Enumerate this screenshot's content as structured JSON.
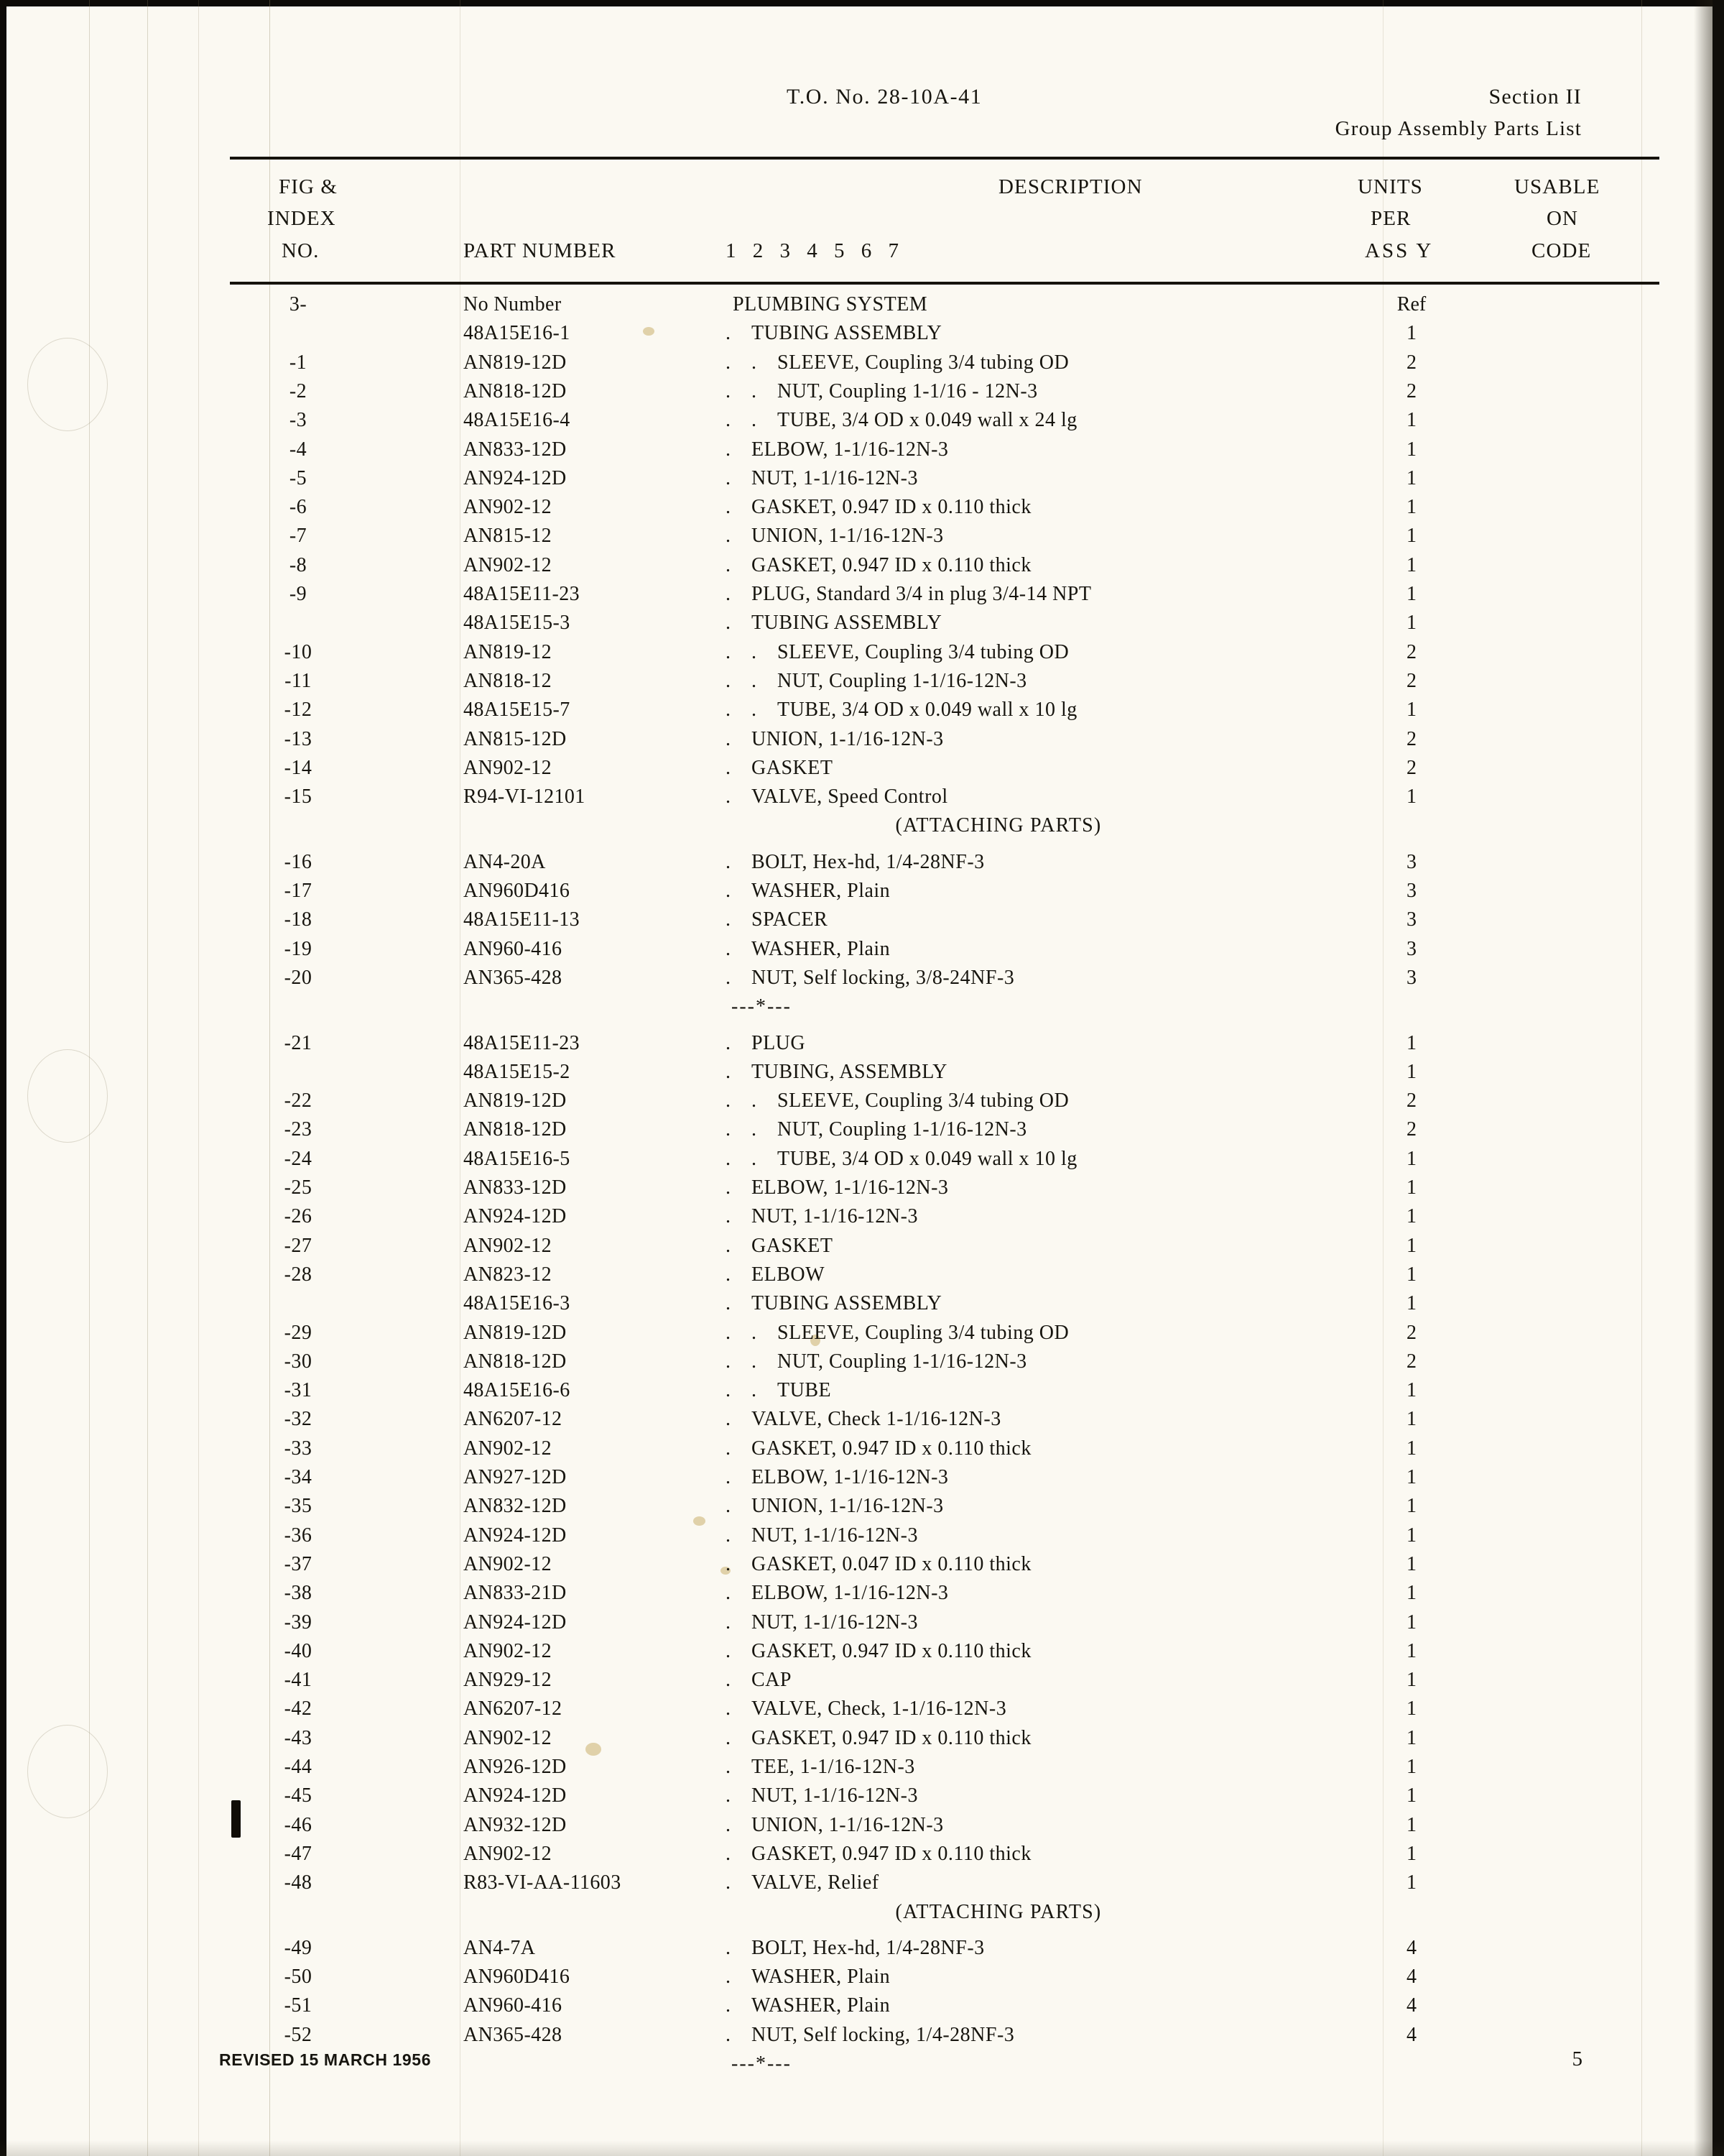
{
  "header": {
    "doc_title": "T.O. No. 28-10A-41",
    "section": "Section II",
    "section_sub": "Group Assembly Parts List"
  },
  "columns": {
    "fig": "FIG &",
    "index": "INDEX",
    "no": "NO.",
    "part_number": "PART NUMBER",
    "desc_digits": "1 2 3 4 5 6 7",
    "description": "DESCRIPTION",
    "units": "UNITS",
    "per": "PER",
    "assy": "ASS Y",
    "usable": "USABLE",
    "on": "ON",
    "code": "CODE"
  },
  "separator_glyph": "---*---",
  "attaching_parts_label": "(ATTACHING PARTS)",
  "rows": [
    {
      "index": "3-",
      "part": "No Number",
      "indent": 0,
      "desc": "PLUMBING SYSTEM",
      "units": "Ref"
    },
    {
      "index": "",
      "part": "48A15E16-1",
      "indent": 1,
      "desc": "TUBING ASSEMBLY",
      "units": "1"
    },
    {
      "index": "-1",
      "part": "AN819-12D",
      "indent": 2,
      "desc": "SLEEVE, Coupling 3/4 tubing OD",
      "units": "2"
    },
    {
      "index": "-2",
      "part": "AN818-12D",
      "indent": 2,
      "desc": "NUT, Coupling 1-1/16 - 12N-3",
      "units": "2"
    },
    {
      "index": "-3",
      "part": "48A15E16-4",
      "indent": 2,
      "desc": "TUBE, 3/4 OD x 0.049 wall x 24 lg",
      "units": "1"
    },
    {
      "index": "-4",
      "part": "AN833-12D",
      "indent": 1,
      "desc": "ELBOW, 1-1/16-12N-3",
      "units": "1"
    },
    {
      "index": "-5",
      "part": "AN924-12D",
      "indent": 1,
      "desc": "NUT, 1-1/16-12N-3",
      "units": "1"
    },
    {
      "index": "-6",
      "part": "AN902-12",
      "indent": 1,
      "desc": "GASKET, 0.947 ID x 0.110 thick",
      "units": "1"
    },
    {
      "index": "-7",
      "part": "AN815-12",
      "indent": 1,
      "desc": "UNION, 1-1/16-12N-3",
      "units": "1"
    },
    {
      "index": "-8",
      "part": "AN902-12",
      "indent": 1,
      "desc": "GASKET, 0.947 ID x 0.110 thick",
      "units": "1"
    },
    {
      "index": "-9",
      "part": "48A15E11-23",
      "indent": 1,
      "desc": "PLUG, Standard 3/4 in plug 3/4-14 NPT",
      "units": "1"
    },
    {
      "index": "",
      "part": "48A15E15-3",
      "indent": 1,
      "desc": "TUBING ASSEMBLY",
      "units": "1"
    },
    {
      "index": "-10",
      "part": "AN819-12",
      "indent": 2,
      "desc": "SLEEVE, Coupling 3/4 tubing OD",
      "units": "2"
    },
    {
      "index": "-11",
      "part": "AN818-12",
      "indent": 2,
      "desc": "NUT, Coupling 1-1/16-12N-3",
      "units": "2"
    },
    {
      "index": "-12",
      "part": "48A15E15-7",
      "indent": 2,
      "desc": "TUBE, 3/4 OD x 0.049 wall x 10 lg",
      "units": "1"
    },
    {
      "index": "-13",
      "part": "AN815-12D",
      "indent": 1,
      "desc": "UNION, 1-1/16-12N-3",
      "units": "2"
    },
    {
      "index": "-14",
      "part": "AN902-12",
      "indent": 1,
      "desc": "GASKET",
      "units": "2"
    },
    {
      "index": "-15",
      "part": "R94-VI-12101",
      "indent": 1,
      "desc": "VALVE, Speed Control",
      "units": "1"
    },
    {
      "type": "attaching"
    },
    {
      "index": "-16",
      "part": "AN4-20A",
      "indent": 1,
      "desc": "BOLT, Hex-hd, 1/4-28NF-3",
      "units": "3"
    },
    {
      "index": "-17",
      "part": "AN960D416",
      "indent": 1,
      "desc": "WASHER, Plain",
      "units": "3"
    },
    {
      "index": "-18",
      "part": "48A15E11-13",
      "indent": 1,
      "desc": "SPACER",
      "units": "3"
    },
    {
      "index": "-19",
      "part": "AN960-416",
      "indent": 1,
      "desc": "WASHER, Plain",
      "units": "3"
    },
    {
      "index": "-20",
      "part": "AN365-428",
      "indent": 1,
      "desc": "NUT, Self locking, 3/8-24NF-3",
      "units": "3"
    },
    {
      "type": "separator"
    },
    {
      "index": "-21",
      "part": "48A15E11-23",
      "indent": 1,
      "desc": "PLUG",
      "units": "1"
    },
    {
      "index": "",
      "part": "48A15E15-2",
      "indent": 1,
      "desc": "TUBING, ASSEMBLY",
      "units": "1"
    },
    {
      "index": "-22",
      "part": "AN819-12D",
      "indent": 2,
      "desc": "SLEEVE, Coupling 3/4 tubing OD",
      "units": "2"
    },
    {
      "index": "-23",
      "part": "AN818-12D",
      "indent": 2,
      "desc": "NUT, Coupling 1-1/16-12N-3",
      "units": "2"
    },
    {
      "index": "-24",
      "part": "48A15E16-5",
      "indent": 2,
      "desc": "TUBE, 3/4 OD x 0.049 wall x 10 lg",
      "units": "1"
    },
    {
      "index": "-25",
      "part": "AN833-12D",
      "indent": 1,
      "desc": "ELBOW, 1-1/16-12N-3",
      "units": "1"
    },
    {
      "index": "-26",
      "part": "AN924-12D",
      "indent": 1,
      "desc": "NUT, 1-1/16-12N-3",
      "units": "1"
    },
    {
      "index": "-27",
      "part": "AN902-12",
      "indent": 1,
      "desc": "GASKET",
      "units": "1"
    },
    {
      "index": "-28",
      "part": "AN823-12",
      "indent": 1,
      "desc": "ELBOW",
      "units": "1"
    },
    {
      "index": "",
      "part": "48A15E16-3",
      "indent": 1,
      "desc": "TUBING ASSEMBLY",
      "units": "1"
    },
    {
      "index": "-29",
      "part": "AN819-12D",
      "indent": 2,
      "desc": "SLEEVE, Coupling 3/4 tubing OD",
      "units": "2"
    },
    {
      "index": "-30",
      "part": "AN818-12D",
      "indent": 2,
      "desc": "NUT, Coupling 1-1/16-12N-3",
      "units": "2"
    },
    {
      "index": "-31",
      "part": "48A15E16-6",
      "indent": 2,
      "desc": "TUBE",
      "units": "1"
    },
    {
      "index": "-32",
      "part": "AN6207-12",
      "indent": 1,
      "desc": "VALVE, Check 1-1/16-12N-3",
      "units": "1"
    },
    {
      "index": "-33",
      "part": "AN902-12",
      "indent": 1,
      "desc": "GASKET, 0.947 ID x 0.110 thick",
      "units": "1"
    },
    {
      "index": "-34",
      "part": "AN927-12D",
      "indent": 1,
      "desc": "ELBOW, 1-1/16-12N-3",
      "units": "1"
    },
    {
      "index": "-35",
      "part": "AN832-12D",
      "indent": 1,
      "desc": "UNION, 1-1/16-12N-3",
      "units": "1"
    },
    {
      "index": "-36",
      "part": "AN924-12D",
      "indent": 1,
      "desc": "NUT, 1-1/16-12N-3",
      "units": "1"
    },
    {
      "index": "-37",
      "part": "AN902-12",
      "indent": 1,
      "desc": "GASKET, 0.047 ID x 0.110 thick",
      "units": "1"
    },
    {
      "index": "-38",
      "part": "AN833-21D",
      "indent": 1,
      "desc": "ELBOW, 1-1/16-12N-3",
      "units": "1"
    },
    {
      "index": "-39",
      "part": "AN924-12D",
      "indent": 1,
      "desc": "NUT, 1-1/16-12N-3",
      "units": "1"
    },
    {
      "index": "-40",
      "part": "AN902-12",
      "indent": 1,
      "desc": "GASKET, 0.947 ID x 0.110 thick",
      "units": "1"
    },
    {
      "index": "-41",
      "part": "AN929-12",
      "indent": 1,
      "desc": "CAP",
      "units": "1"
    },
    {
      "index": "-42",
      "part": "AN6207-12",
      "indent": 1,
      "desc": "VALVE, Check, 1-1/16-12N-3",
      "units": "1"
    },
    {
      "index": "-43",
      "part": "AN902-12",
      "indent": 1,
      "desc": "GASKET, 0.947 ID x 0.110 thick",
      "units": "1"
    },
    {
      "index": "-44",
      "part": "AN926-12D",
      "indent": 1,
      "desc": "TEE, 1-1/16-12N-3",
      "units": "1"
    },
    {
      "index": "-45",
      "part": "AN924-12D",
      "indent": 1,
      "desc": "NUT, 1-1/16-12N-3",
      "units": "1"
    },
    {
      "index": "-46",
      "part": "AN932-12D",
      "indent": 1,
      "desc": "UNION, 1-1/16-12N-3",
      "units": "1"
    },
    {
      "index": "-47",
      "part": "AN902-12",
      "indent": 1,
      "desc": "GASKET, 0.947 ID x 0.110 thick",
      "units": "1"
    },
    {
      "index": "-48",
      "part": "R83-VI-AA-11603",
      "indent": 1,
      "desc": "VALVE, Relief",
      "units": "1",
      "change_bar": true
    },
    {
      "type": "attaching"
    },
    {
      "index": "-49",
      "part": "AN4-7A",
      "indent": 1,
      "desc": "BOLT, Hex-hd, 1/4-28NF-3",
      "units": "4"
    },
    {
      "index": "-50",
      "part": "AN960D416",
      "indent": 1,
      "desc": "WASHER, Plain",
      "units": "4"
    },
    {
      "index": "-51",
      "part": "AN960-416",
      "indent": 1,
      "desc": "WASHER, Plain",
      "units": "4"
    },
    {
      "index": "-52",
      "part": "AN365-428",
      "indent": 1,
      "desc": "NUT, Self locking, 1/4-28NF-3",
      "units": "4"
    },
    {
      "type": "separator"
    }
  ],
  "footer": {
    "revised": "REVISED 15 MARCH 1956",
    "page": "5"
  }
}
